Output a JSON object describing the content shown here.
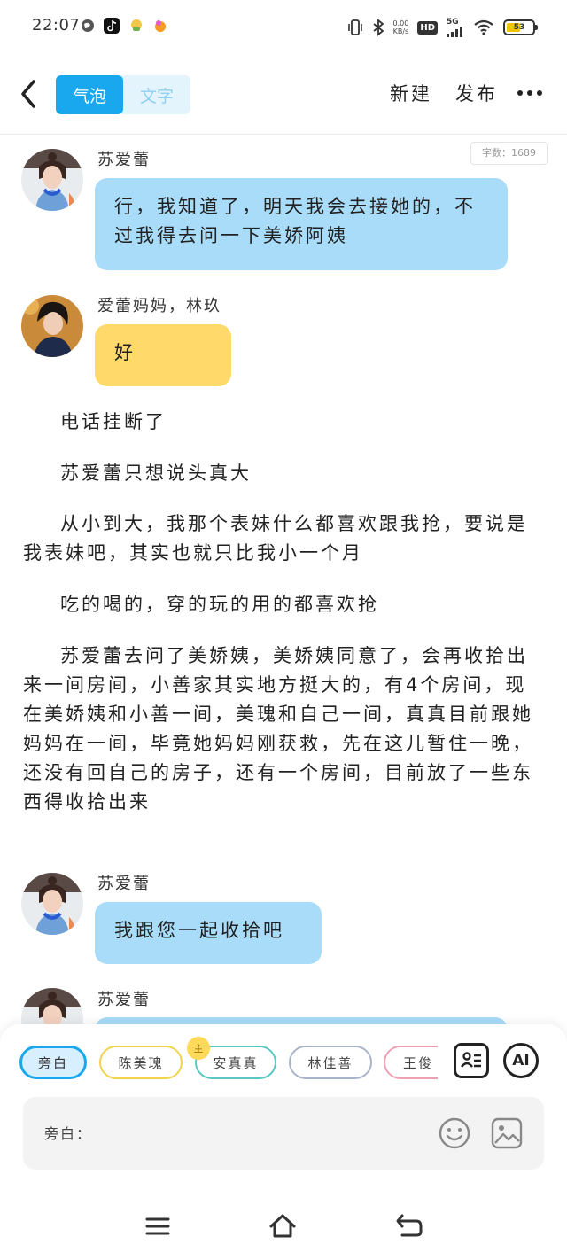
{
  "status_bar": {
    "time": "22:07",
    "net_speed_value": "0.00",
    "net_speed_unit": "KB/s",
    "hd": "HD",
    "network": "5G",
    "battery": "53",
    "battery_level": 0.53
  },
  "header": {
    "tabs": [
      {
        "label": "气泡",
        "active": true
      },
      {
        "label": "文字",
        "active": false
      }
    ],
    "new_label": "新建",
    "publish_label": "发布"
  },
  "word_count": "字数：1689",
  "messages": [
    {
      "speaker": "苏爱蕾",
      "text": "行，我知道了，明天我会去接她的，不过我得去问一下美娇阿姨",
      "color": "#a8dcf8"
    },
    {
      "speaker": "爱蕾妈妈，林玖",
      "text": "好",
      "color": "#ffd96a"
    },
    {
      "speaker": "苏爱蕾",
      "text": "我跟您一起收拾吧",
      "color": "#a8dcf8"
    },
    {
      "speaker": "苏爱蕾",
      "text": "",
      "color": "#a8dcf8"
    }
  ],
  "narration": [
    "电话挂断了",
    "苏爱蕾只想说头真大",
    "从小到大，我那个表妹什么都喜欢跟我抢，要说是我表妹吧，其实也就只比我小一个月",
    "吃的喝的，穿的玩的用的都喜欢抢",
    "苏爱蕾去问了美娇姨，美娇姨同意了，会再收拾出来一间房间，小善家其实地方挺大的，有4个房间，现在美娇姨和小善一间，美瑰和自己一间，真真目前跟她妈妈在一间，毕竟她妈妈刚获救，先在这儿暂住一晚，还没有回自己的房子，还有一个房间，目前放了一些东西得收拾出来"
  ],
  "composer": {
    "characters": [
      {
        "name": "旁白",
        "border": "#19a8ee",
        "selected": true
      },
      {
        "name": "陈美瑰",
        "border": "#f2d34a",
        "selected": false
      },
      {
        "name": "安真真",
        "border": "#5ac8c0",
        "selected": false
      },
      {
        "name": "林佳善",
        "border": "#a8b4c8",
        "selected": false
      },
      {
        "name": "王俊",
        "border": "#f0a0b4",
        "selected": false
      }
    ],
    "main_badge": "主",
    "ai_label": "AI",
    "input_label": "旁白："
  }
}
